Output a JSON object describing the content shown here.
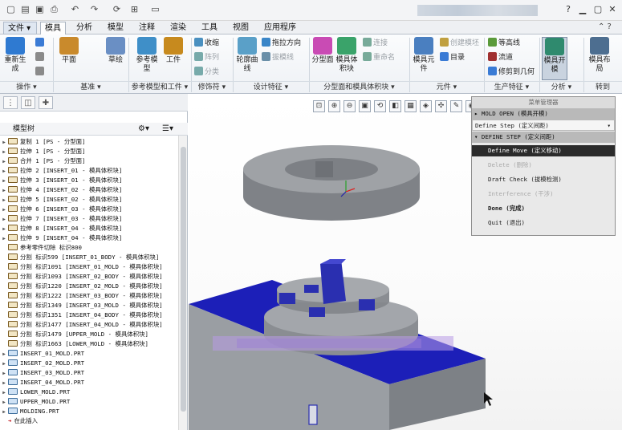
{
  "quick_access": {
    "icons": [
      "new-file-icon",
      "open-file-icon",
      "save-icon",
      "print-icon",
      "undo-icon",
      "redo-icon",
      "regenerate-icon",
      "windows-icon",
      "folder-icon"
    ]
  },
  "tabs": [
    "文件",
    "模具",
    "分析",
    "模型",
    "注释",
    "渲染",
    "工具",
    "视图",
    "应用程序"
  ],
  "active_tab": "模具",
  "ribbon": {
    "big": [
      {
        "label": "重新生成",
        "color": "#2f7ad1"
      },
      {
        "label": "平面",
        "color": "#c98a2c"
      },
      {
        "label": "草绘",
        "color": "#6a8fc4"
      },
      {
        "label": "参考模型",
        "color": "#3f8fc8"
      },
      {
        "label": "工件",
        "color": "#c78a1e"
      },
      {
        "label": "轮廓曲线",
        "color": "#5aa0c8"
      },
      {
        "label": "分型面",
        "color": "#c94bb4"
      },
      {
        "label": "模具体积块",
        "color": "#3aa36a"
      },
      {
        "label": "模具元件",
        "color": "#4a7fc0"
      },
      {
        "label": "模具开模",
        "color": "#2f8a6e"
      },
      {
        "label": "模具布局",
        "color": "#4d6e90"
      }
    ],
    "small": [
      {
        "label": "",
        "disabled": false
      },
      {
        "label": "",
        "disabled": false
      },
      {
        "label": "",
        "disabled": false
      },
      {
        "label": "收缩",
        "disabled": false
      },
      {
        "label": "阵列",
        "disabled": true
      },
      {
        "label": "分类",
        "disabled": true
      },
      {
        "label": "拖拉方向",
        "disabled": false
      },
      {
        "label": "拔模线",
        "disabled": true
      },
      {
        "label": "连接",
        "disabled": true
      },
      {
        "label": "重命名",
        "disabled": true
      },
      {
        "label": "创建模坯",
        "disabled": true
      },
      {
        "label": "目录",
        "disabled": false
      },
      {
        "label": "等高线",
        "disabled": false
      },
      {
        "label": "流道",
        "disabled": false
      },
      {
        "label": "修剪到几何",
        "disabled": false
      }
    ],
    "groups": [
      "操作",
      "基准",
      "参考模型和工件",
      "修饰符",
      "设计特征",
      "分型面和模具体积块",
      "元件",
      "生产特征",
      "分析",
      "转到"
    ]
  },
  "panel": {
    "tab_icons": [
      "model-tree-icon",
      "layer-icon",
      "favorites-icon"
    ],
    "tree_title": "模型树",
    "items": [
      {
        "text": "复制 1 [PS - 分型面]",
        "expandable": true,
        "icon": "op"
      },
      {
        "text": "拉伸 1 [PS - 分型面]",
        "expandable": true,
        "icon": "op"
      },
      {
        "text": "合并 1 [PS - 分型面]",
        "expandable": true,
        "icon": "op"
      },
      {
        "text": "拉伸 2 [INSERT_01 - 模具体积块]",
        "expandable": true,
        "icon": "op"
      },
      {
        "text": "拉伸 3 [INSERT_01 - 模具体积块]",
        "expandable": true,
        "icon": "op"
      },
      {
        "text": "拉伸 4 [INSERT_02 - 模具体积块]",
        "expandable": true,
        "icon": "op"
      },
      {
        "text": "拉伸 5 [INSERT_02 - 模具体积块]",
        "expandable": true,
        "icon": "op"
      },
      {
        "text": "拉伸 6 [INSERT_03 - 模具体积块]",
        "expandable": true,
        "icon": "op"
      },
      {
        "text": "拉伸 7 [INSERT_03 - 模具体积块]",
        "expandable": true,
        "icon": "op"
      },
      {
        "text": "拉伸 8 [INSERT_04 - 模具体积块]",
        "expandable": true,
        "icon": "op"
      },
      {
        "text": "拉伸 9 [INSERT_04 - 模具体积块]",
        "expandable": true,
        "icon": "op"
      },
      {
        "text": "参考零件切除 标识800",
        "expandable": false,
        "icon": "op"
      },
      {
        "text": "分割 标识599 [INSERT_01_BODY - 模具体积块]",
        "expandable": false,
        "icon": "op"
      },
      {
        "text": "分割 标识1091 [INSERT_01_MOLD - 模具体积块]",
        "expandable": false,
        "icon": "op"
      },
      {
        "text": "分割 标识1093 [INSERT_02_BODY - 模具体积块]",
        "expandable": false,
        "icon": "op"
      },
      {
        "text": "分割 标识1220 [INSERT_02_MOLD - 模具体积块]",
        "expandable": false,
        "icon": "op"
      },
      {
        "text": "分割 标识1222 [INSERT_03_BODY - 模具体积块]",
        "expandable": false,
        "icon": "op"
      },
      {
        "text": "分割 标识1349 [INSERT_03_MOLD - 模具体积块]",
        "expandable": false,
        "icon": "op"
      },
      {
        "text": "分割 标识1351 [INSERT_04_BODY - 模具体积块]",
        "expandable": false,
        "icon": "op"
      },
      {
        "text": "分割 标识1477 [INSERT_04_MOLD - 模具体积块]",
        "expandable": false,
        "icon": "op"
      },
      {
        "text": "分割 标识1479 [UPPER_MOLD - 模具体积块]",
        "expandable": false,
        "icon": "op"
      },
      {
        "text": "分割 标识1663 [LOWER_MOLD - 模具体积块]",
        "expandable": false,
        "icon": "op"
      },
      {
        "text": "INSERT_01_MOLD.PRT",
        "expandable": true,
        "icon": "pt"
      },
      {
        "text": "INSERT_02_MOLD.PRT",
        "expandable": true,
        "icon": "pt"
      },
      {
        "text": "INSERT_03_MOLD.PRT",
        "expandable": true,
        "icon": "pt"
      },
      {
        "text": "INSERT_04_MOLD.PRT",
        "expandable": true,
        "icon": "pt"
      },
      {
        "text": "LOWER_MOLD.PRT",
        "expandable": true,
        "icon": "pt"
      },
      {
        "text": "UPPER_MOLD.PRT",
        "expandable": true,
        "icon": "pt"
      },
      {
        "text": "MOLDING.PRT",
        "expandable": true,
        "icon": "pt"
      },
      {
        "text": "在此插入",
        "expandable": false,
        "icon": "insert"
      }
    ]
  },
  "view_toolbar": [
    "zoom-fit-icon",
    "zoom-in-icon",
    "zoom-out-icon",
    "repaint-icon",
    "orientation-icon",
    "saved-views-icon",
    "display-style-icon",
    "datum-display-icon",
    "spin-center-icon",
    "annotation-icon",
    "simulation-icon"
  ],
  "menu_manager": {
    "title": "菜单管理器",
    "rows": [
      {
        "text": "▸ MOLD OPEN (模具开模)",
        "type": "head"
      },
      {
        "text": "Define Step (定义间距)",
        "type": "item",
        "arrow": "▾"
      },
      {
        "text": "▾ DEFINE STEP (定义间距)",
        "type": "head"
      },
      {
        "text": "Define Move (定义移动)",
        "type": "selected"
      },
      {
        "text": "Delete (删除)",
        "type": "disabled"
      },
      {
        "text": "Draft Check (拔模检测)",
        "type": "item"
      },
      {
        "text": "Interference (干涉)",
        "type": "disabled"
      },
      {
        "text": "Done (完成)",
        "type": "bold"
      },
      {
        "text": "Quit (退出)",
        "type": "item"
      }
    ]
  },
  "colors": {
    "blue_plate": "#1c1fb8",
    "gray_part": "#8a8d92",
    "menu_selected": "#2b2b2b",
    "ribbon_bg": "#f5f7fa"
  }
}
